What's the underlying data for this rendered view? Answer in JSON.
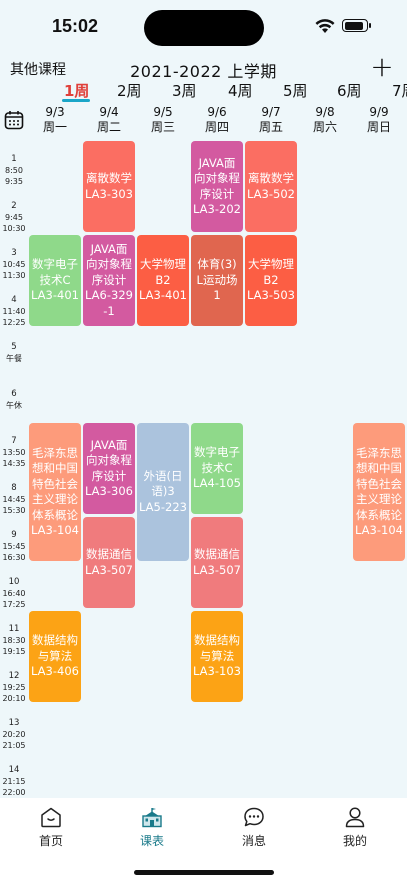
{
  "status_bar": {
    "time": "15:02"
  },
  "header": {
    "other_courses": "其他课程",
    "term_title": "2021-2022 上学期",
    "add_label": "+"
  },
  "week_tabs": [
    "1周",
    "2周",
    "3周",
    "4周",
    "5周",
    "6周",
    "7周"
  ],
  "active_week": "1周",
  "days": [
    {
      "date": "9/3",
      "weekday": "周一"
    },
    {
      "date": "9/4",
      "weekday": "周二"
    },
    {
      "date": "9/5",
      "weekday": "周三"
    },
    {
      "date": "9/6",
      "weekday": "周四"
    },
    {
      "date": "9/7",
      "weekday": "周五"
    },
    {
      "date": "9/8",
      "weekday": "周六"
    },
    {
      "date": "9/9",
      "weekday": "周日"
    }
  ],
  "periods": [
    {
      "num": "1",
      "start": "8:50",
      "end": "9:35"
    },
    {
      "num": "2",
      "start": "9:45",
      "end": "10:30"
    },
    {
      "num": "3",
      "start": "10:45",
      "end": "11:30"
    },
    {
      "num": "4",
      "start": "11:40",
      "end": "12:25"
    },
    {
      "num": "5",
      "start": "午餐",
      "end": ""
    },
    {
      "num": "6",
      "start": "午休",
      "end": ""
    },
    {
      "num": "7",
      "start": "13:50",
      "end": "14:35"
    },
    {
      "num": "8",
      "start": "14:45",
      "end": "15:30"
    },
    {
      "num": "9",
      "start": "15:45",
      "end": "16:30"
    },
    {
      "num": "10",
      "start": "16:40",
      "end": "17:25"
    },
    {
      "num": "11",
      "start": "18:30",
      "end": "19:15"
    },
    {
      "num": "12",
      "start": "19:25",
      "end": "20:10"
    },
    {
      "num": "13",
      "start": "20:20",
      "end": "21:05"
    },
    {
      "num": "14",
      "start": "21:15",
      "end": "22:00"
    }
  ],
  "courses": [
    {
      "name": "离散数学",
      "room": "LA3-303",
      "color": "#fb6e62"
    },
    {
      "name": "JAVA面向对象程序设计",
      "room": "LA3-202",
      "color": "#d35aa0"
    },
    {
      "name": "离散数学",
      "room": "LA3-502",
      "color": "#fb6e62"
    },
    {
      "name": "数字电子技术C",
      "room": "LA3-401",
      "color": "#8fd98a"
    },
    {
      "name": "JAVA面向对象程序设计",
      "room": "LA6-329-1",
      "color": "#d35aa0"
    },
    {
      "name": "大学物理B2",
      "room": "LA3-401",
      "color": "#fc5e44"
    },
    {
      "name": "体育(3)",
      "room": "L运动场1",
      "color": "#e0664f"
    },
    {
      "name": "大学物理B2",
      "room": "LA3-503",
      "color": "#fc5e44"
    },
    {
      "name": "毛泽东思想和中国特色社会主义理论体系概论",
      "room": "LA3-104",
      "color": "#fd9b7b"
    },
    {
      "name": "JAVA面向对象程序设计",
      "room": "LA3-306",
      "color": "#d35aa0"
    },
    {
      "name": "外语(日语)3",
      "room": "LA5-223",
      "color": "#abc3dd"
    },
    {
      "name": "数字电子技术C",
      "room": "LA4-105",
      "color": "#8fd98a"
    },
    {
      "name": "毛泽东思想和中国特色社会主义理论体系概论",
      "room": "LA3-104",
      "color": "#fd9b7b"
    },
    {
      "name": "数据通信",
      "room": "LA3-507",
      "color": "#f07b7d"
    },
    {
      "name": "数据通信",
      "room": "LA3-507",
      "color": "#f07b7d"
    },
    {
      "name": "数据结构与算法",
      "room": "LA3-406",
      "color": "#fca315"
    },
    {
      "name": "数据结构与算法",
      "room": "LA3-103",
      "color": "#fca315"
    }
  ],
  "tab_bar": {
    "items": [
      {
        "label": "首页",
        "icon": "home-icon"
      },
      {
        "label": "课表",
        "icon": "schedule-icon"
      },
      {
        "label": "消息",
        "icon": "message-icon"
      },
      {
        "label": "我的",
        "icon": "profile-icon"
      }
    ],
    "active": "课表",
    "accent_color": "#1a7a8a"
  }
}
